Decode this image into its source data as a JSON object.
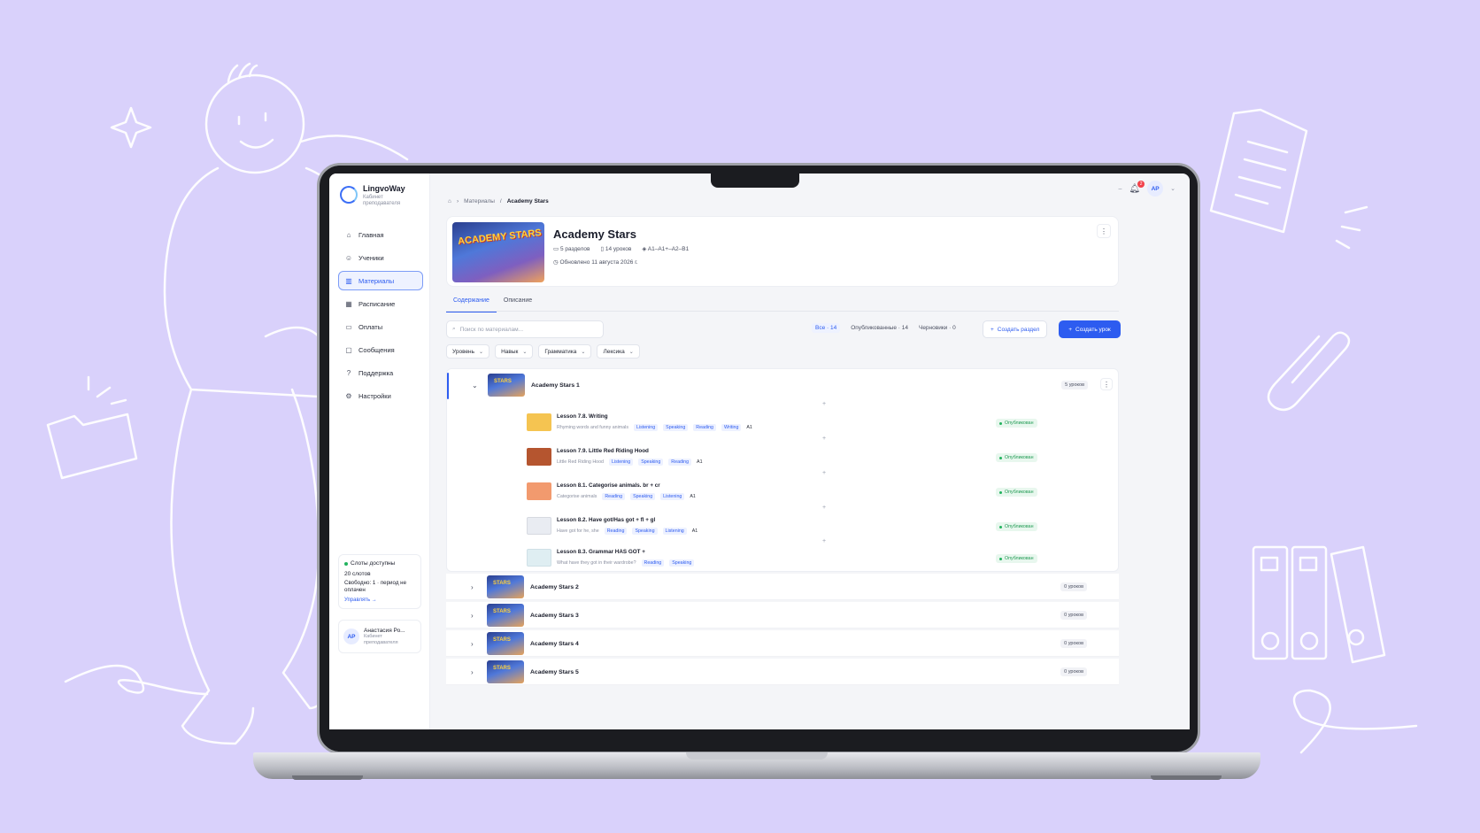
{
  "brand": {
    "name": "LingvoWay",
    "subtitle": "Кабинет преподавателя"
  },
  "sidebar": {
    "items": [
      {
        "label": "Главная",
        "icon": "home-icon",
        "active": false
      },
      {
        "label": "Ученики",
        "icon": "users-icon",
        "active": false
      },
      {
        "label": "Материалы",
        "icon": "books-icon",
        "active": true
      },
      {
        "label": "Расписание",
        "icon": "calendar-icon",
        "active": false
      },
      {
        "label": "Оплаты",
        "icon": "card-icon",
        "active": false
      },
      {
        "label": "Сообщения",
        "icon": "message-icon",
        "active": false
      },
      {
        "label": "Поддержка",
        "icon": "help-icon",
        "active": false
      },
      {
        "label": "Настройки",
        "icon": "gear-icon",
        "active": false
      }
    ],
    "slots": {
      "title": "Слоты доступны",
      "count": "20 слотов",
      "free": "Свободно: 1 · период не оплачен",
      "link": "Управлять →"
    },
    "user": {
      "initials": "АР",
      "name": "Анастасия Ро...",
      "role": "Кабинет преподавателя"
    }
  },
  "topbar": {
    "notifications": "2",
    "initials": "АР"
  },
  "breadcrumb": {
    "parent": "Материалы",
    "current": "Academy Stars"
  },
  "course": {
    "title": "Academy Stars",
    "cover_text": "ACADEMY STARS",
    "sections": "5 разделов",
    "lessons": "14 уроков",
    "levels": "A1–A1+–A2–B1",
    "updated": "Обновлено 11 августа 2026 г."
  },
  "tabs": [
    {
      "label": "Содержание",
      "active": true
    },
    {
      "label": "Описание",
      "active": false
    }
  ],
  "search": {
    "placeholder": "Поиск по материалам..."
  },
  "counters": {
    "all": "Все · 14",
    "published": "Опубликованные · 14",
    "drafts": "Черновики · 0"
  },
  "buttons": {
    "create_section": "Создать раздел",
    "create_lesson": "Создать урок"
  },
  "filters": [
    "Уровень",
    "Навык",
    "Грамматика",
    "Лексика"
  ],
  "sections": [
    {
      "title": "Academy Stars 1",
      "count": "5 уроков",
      "expanded": true,
      "lessons": [
        {
          "title": "Lesson 7.8. Writing",
          "subtitle": "Rhyming words and funny animals",
          "skills": [
            "Listening",
            "Speaking",
            "Reading",
            "Writing"
          ],
          "level": "A1",
          "status": "Опубликован",
          "thumb_color": "#f5c451"
        },
        {
          "title": "Lesson 7.9. Little Red Riding Hood",
          "subtitle": "Little Red Riding Hood",
          "skills": [
            "Listening",
            "Speaking",
            "Reading"
          ],
          "level": "A1",
          "status": "Опубликован",
          "thumb_color": "#b5552f"
        },
        {
          "title": "Lesson 8.1. Categorise animals. br + cr",
          "subtitle": "Categorise animals",
          "skills": [
            "Reading",
            "Speaking",
            "Listening"
          ],
          "level": "A1",
          "status": "Опубликован",
          "thumb_color": "#f29a6e"
        },
        {
          "title": "Lesson 8.2. Have got/Has got + fl + gl",
          "subtitle": "Have got for he, she",
          "skills": [
            "Reading",
            "Speaking",
            "Listening"
          ],
          "level": "A1",
          "status": "Опубликован",
          "thumb_color": "#e9ecf2"
        },
        {
          "title": "Lesson 8.3. Grammar HAS GOT +",
          "subtitle": "What have they got in their wardrobe?",
          "skills": [
            "Reading",
            "Speaking"
          ],
          "level": "",
          "status": "Опубликован",
          "thumb_color": "#dfeef2"
        }
      ]
    },
    {
      "title": "Academy Stars 2",
      "count": "0 уроков",
      "expanded": false
    },
    {
      "title": "Academy Stars 3",
      "count": "0 уроков",
      "expanded": false
    },
    {
      "title": "Academy Stars 4",
      "count": "0 уроков",
      "expanded": false
    },
    {
      "title": "Academy Stars 5",
      "count": "0 уроков",
      "expanded": false
    }
  ]
}
